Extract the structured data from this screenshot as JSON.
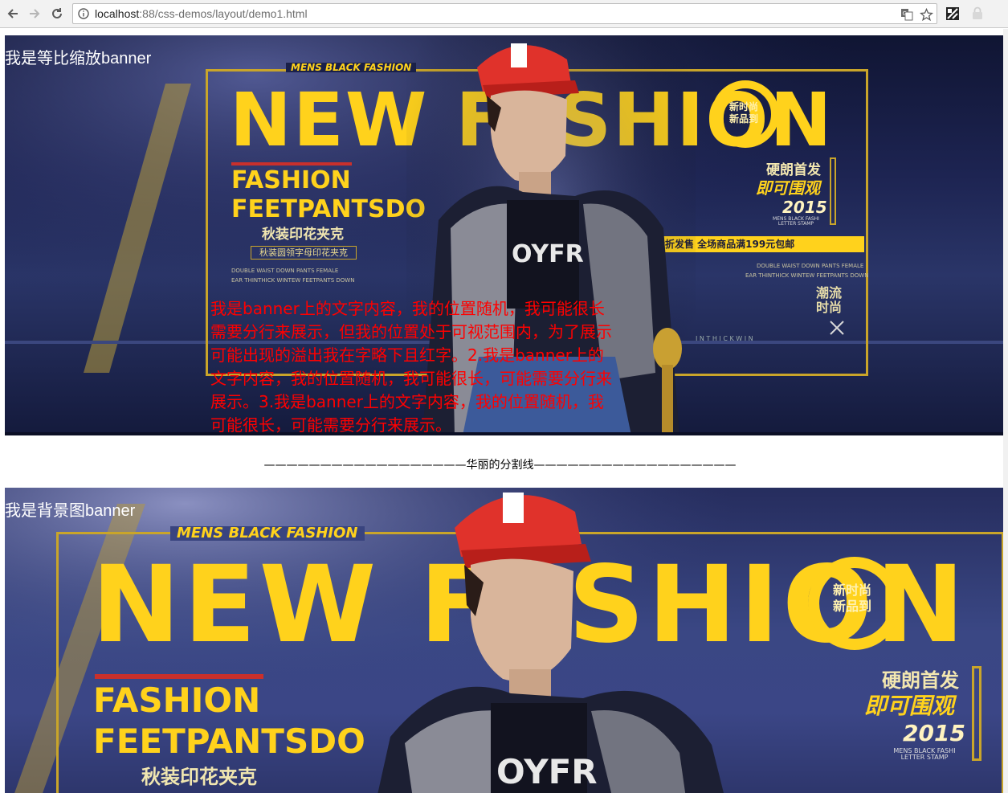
{
  "browser": {
    "url_host": "localhost",
    "url_rest": ":88/css-demos/layout/demo1.html",
    "icons": [
      "back-arrow-icon",
      "forward-arrow-icon",
      "reload-icon",
      "info-icon",
      "translate-icon",
      "star-icon",
      "extension-icon",
      "profile-icon"
    ]
  },
  "page": {
    "banner1": {
      "label": "我是等比缩放banner",
      "overlay_text": "我是banner上的文字内容，我的位置随机，我可能很长需要分行来展示，但我的位置处于可视范围内，为了展示可能出现的溢出我在字略下且红字。2.我是banner上的文字内容，我的位置随机，我可能很长，可能需要分行来展示。3.我是banner上的文字内容，我的位置随机，我可能很长，可能需要分行来展示。"
    },
    "divider_text": "——————————————————华丽的分割线——————————————————",
    "banner2": {
      "label": "我是背景图banner"
    },
    "artwork": {
      "top_tag": "MENS BLACK FASHION",
      "title": "NEW FASHION",
      "fashion": "FASHION",
      "feet": "FEETPANTSDO",
      "autumn": "秋装印花夹克",
      "autumn_sub": "秋装圆领字母印花夹克",
      "right_1": "硬朗首发",
      "right_2": "即可围观",
      "year": "2015",
      "stamp": "MENS BLACK FASHI LETTER STAMP",
      "promo": "新品六折发售 全场商品满199元包邮",
      "trend": "潮流时尚",
      "badge": "新时尚新品到",
      "shirt": "OYFR",
      "small_left": "DOUBLE WAIST DOWN PANTS FEMALE",
      "small_left2": "EAR THINTHICK WINTEW FEETPANTS DOWN",
      "small_right": "DOUBLE WAIST DOWN PANTS FEMALE",
      "small_right2": "EAR THINTHICK WINTEW FEETPANTS DOWN",
      "bottom_line": "I N T H I C K  W I N"
    },
    "colors": {
      "overlay_text": "#ff0000",
      "label_text": "#ffffff",
      "art_yellow": "#ffd21c",
      "cap_red": "#e0322b"
    }
  }
}
